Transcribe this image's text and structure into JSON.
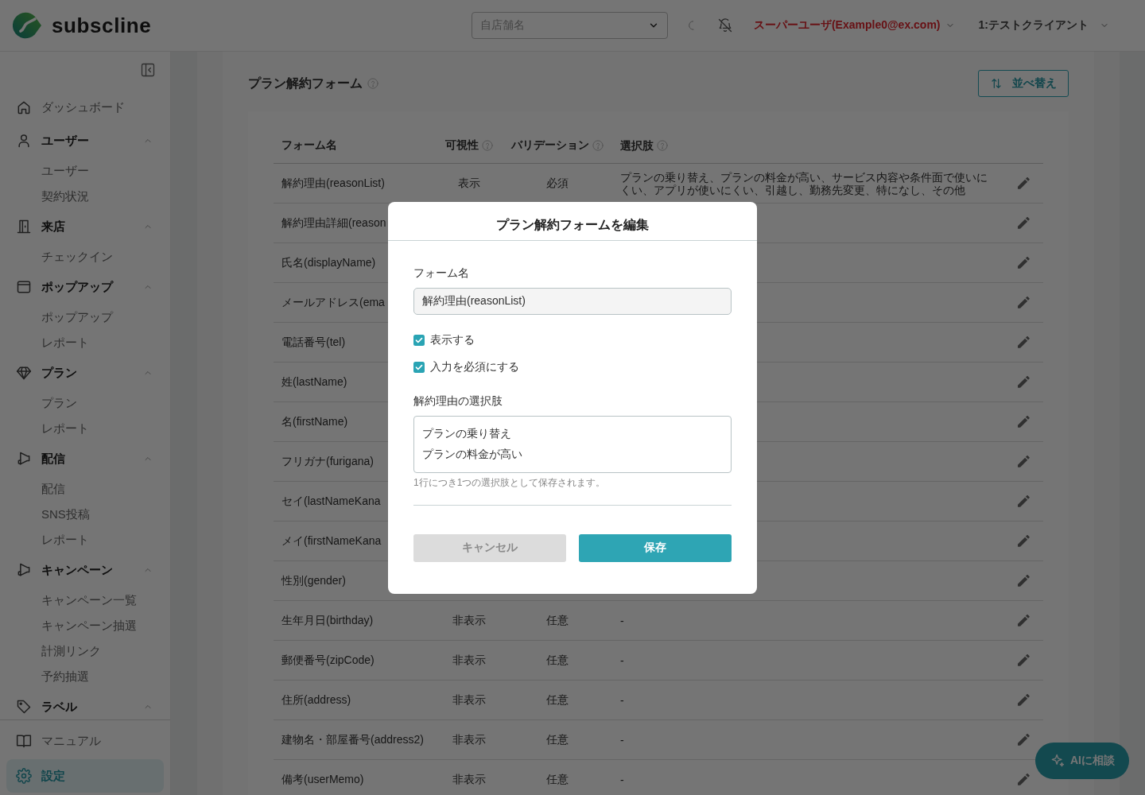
{
  "header": {
    "logo": "subscline",
    "store_select": {
      "placeholder": "自店舗名"
    },
    "user_menu": "スーパーユーザ(Example0@ex.com)",
    "client_menu": "1:テストクライアント"
  },
  "sidebar": {
    "items": [
      {
        "label": "ダッシュボード",
        "kind": "link",
        "selected": false
      },
      {
        "label": "ユーザー",
        "kind": "group",
        "expanded": true,
        "selected": false,
        "children": [
          {
            "label": "ユーザー",
            "selected": false
          },
          {
            "label": "契約状況",
            "selected": false
          }
        ]
      },
      {
        "label": "来店",
        "kind": "group",
        "expanded": true,
        "selected": false,
        "children": [
          {
            "label": "チェックイン",
            "selected": false
          }
        ]
      },
      {
        "label": "ポップアップ",
        "kind": "group",
        "expanded": true,
        "selected": false,
        "children": [
          {
            "label": "ポップアップ",
            "selected": false
          },
          {
            "label": "レポート",
            "selected": false
          }
        ]
      },
      {
        "label": "プラン",
        "kind": "group",
        "expanded": true,
        "selected": false,
        "children": [
          {
            "label": "プラン",
            "selected": false
          },
          {
            "label": "レポート",
            "selected": false
          }
        ]
      },
      {
        "label": "配信",
        "kind": "group",
        "expanded": true,
        "selected": false,
        "children": [
          {
            "label": "配信",
            "selected": false
          },
          {
            "label": "SNS投稿",
            "selected": false
          },
          {
            "label": "レポート",
            "selected": false
          }
        ]
      },
      {
        "label": "キャンペーン",
        "kind": "group",
        "expanded": true,
        "selected": false,
        "children": [
          {
            "label": "キャンペーン一覧",
            "selected": false
          },
          {
            "label": "キャンペーン抽選",
            "selected": false
          },
          {
            "label": "計測リンク",
            "selected": false
          },
          {
            "label": "予約抽選",
            "selected": false
          }
        ]
      },
      {
        "label": "ラベル",
        "kind": "group",
        "expanded": true,
        "selected": false
      }
    ],
    "footer_items": [
      {
        "label": "マニュアル",
        "selected": false
      },
      {
        "label": "設定",
        "selected": true
      }
    ]
  },
  "page": {
    "title": "プラン解約フォーム",
    "title_help": true,
    "sort_button": "並べ替え",
    "table": {
      "columns": [
        {
          "label": "フォーム名",
          "help": false
        },
        {
          "label": "可視性",
          "help": true
        },
        {
          "label": "バリデーション",
          "help": true
        },
        {
          "label": "選択肢",
          "help": true
        }
      ],
      "rows": [
        {
          "name": "解約理由(reasonList)",
          "visibility": "表示",
          "validation": "必須",
          "choices": "プランの乗り替え、プランの料金が高い、サービス内容や条件面で使いにくい、アプリが使いにくい、引越し、勤務先変更、特になし、その他"
        },
        {
          "name": "解約理由詳細(reason"
        },
        {
          "name": "氏名(displayName)"
        },
        {
          "name": "メールアドレス(ema"
        },
        {
          "name": "電話番号(tel)"
        },
        {
          "name": "姓(lastName)"
        },
        {
          "name": "名(firstName)"
        },
        {
          "name": "フリガナ(furigana)"
        },
        {
          "name": "セイ(lastNameKana"
        },
        {
          "name": "メイ(firstNameKana"
        },
        {
          "name": "性別(gender)"
        },
        {
          "name": "生年月日(birthday)",
          "visibility": "非表示",
          "validation": "任意",
          "choices": "-"
        },
        {
          "name": "郵便番号(zipCode)",
          "visibility": "非表示",
          "validation": "任意",
          "choices": "-"
        },
        {
          "name": "住所(address)",
          "visibility": "非表示",
          "validation": "任意",
          "choices": "-"
        },
        {
          "name": "建物名・部屋番号(address2)",
          "visibility": "非表示",
          "validation": "任意",
          "choices": "-"
        },
        {
          "name": "備考(userMemo)",
          "visibility": "非表示",
          "validation": "任意",
          "choices": "-"
        }
      ]
    }
  },
  "modal": {
    "title": "プラン解約フォームを編集",
    "name_label": "フォーム名",
    "name_value": "解約理由(reasonList)",
    "checkboxes": [
      {
        "label": "表示する",
        "checked": true
      },
      {
        "label": "入力を必須にする",
        "checked": true
      }
    ],
    "choices_label": "解約理由の選択肢",
    "choices_lines": [
      "プランの乗り替え",
      "プランの料金が高い"
    ],
    "hint": "1行につき1つの選択肢として保存されます。",
    "buttons": [
      {
        "label": "キャンセル",
        "kind": "secondary"
      },
      {
        "label": "保存",
        "kind": "primary"
      }
    ]
  },
  "ai_button": "AIに相談"
}
